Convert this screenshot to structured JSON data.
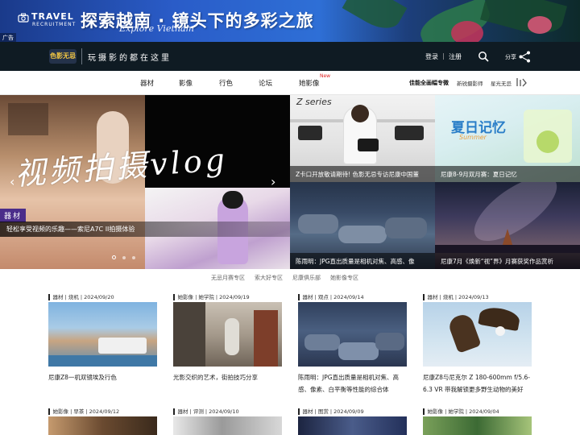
{
  "banner": {
    "brand_big": "TRAVEL",
    "brand_small": "RECRUITMENT",
    "title": "探索越南 · 镜头下的多彩之旅",
    "subtitle": "Explore Vietnam",
    "ad_label": "广告"
  },
  "topbar": {
    "logo_text": "色影无忌",
    "slogan": "玩摄影的都在这里",
    "login": "登录",
    "separator": "|",
    "register": "注册",
    "share": "分享"
  },
  "nav": {
    "items": [
      "器材",
      "影像",
      "行色",
      "论坛",
      "她影像"
    ],
    "new_badge": "New",
    "right_items": [
      "佳能全画幅专微",
      "新锐摄影师",
      "星光无忌"
    ]
  },
  "hero": {
    "script_text": "视频拍摄vlog",
    "tag": "器材",
    "caption": "轻松享受视频的乐趣——索尼A7C II拍摄体验",
    "prev": "‹",
    "next": "›",
    "dots": 3
  },
  "tiles": [
    {
      "overlay": "Z series",
      "caption": "Z卡口开放敬请期待! 色影无忌专访尼康中国董"
    },
    {
      "overlay": "夏日记忆",
      "overlay_sub": "Summer",
      "caption": "尼康8-9月双月赛：夏日记忆"
    },
    {
      "caption": "陈雨明：JPG直出质量是相机对焦、高感、像"
    },
    {
      "caption": "尼康7月《焕新“视”界》月赛获奖作品赏析"
    }
  ],
  "sub_nav": [
    "无忌月赛专区",
    "索大好专区",
    "尼康俱乐部",
    "她影像专区"
  ],
  "cards": [
    {
      "tags": [
        "器材",
        "烧机"
      ],
      "date": "2024/09/20",
      "title": "尼康Z8一机双镜埃及行色"
    },
    {
      "tags": [
        "她影像",
        "她学院"
      ],
      "date": "2024/09/19",
      "title": "光影交织的艺术，街拍技巧分享"
    },
    {
      "tags": [
        "器材",
        "观点"
      ],
      "date": "2024/09/14",
      "title": "陈雨明：JPG直出质量是相机对焦、高感、像素、白平衡等性能的综合体"
    },
    {
      "tags": [
        "器材",
        "烧机"
      ],
      "date": "2024/09/13",
      "title": "尼康Z8与尼克尔 Z 180-600mm f/5.6-6.3 VR 带我解锁更多野生动物的美好"
    },
    {
      "tags": [
        "她影像",
        "早茶"
      ],
      "date": "2024/09/12",
      "title": ""
    },
    {
      "tags": [
        "器材",
        "评测"
      ],
      "date": "2024/09/10",
      "title": ""
    },
    {
      "tags": [
        "器材",
        "图赏"
      ],
      "date": "2024/09/09",
      "title": ""
    },
    {
      "tags": [
        "她影像",
        "她学院"
      ],
      "date": "2024/09/04",
      "title": ""
    }
  ],
  "colors": {
    "topbar_bg": "#0f1b23",
    "tag_purple": "#4b2d8a",
    "new_red": "#e02020"
  }
}
